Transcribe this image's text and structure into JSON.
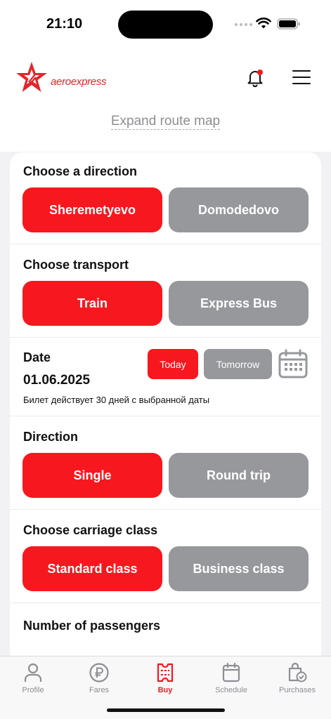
{
  "status_bar": {
    "time": "21:10"
  },
  "header": {
    "logo_text": "aeroexpress",
    "expand_map_label": "Expand route map"
  },
  "sections": {
    "route": {
      "title": "Choose a direction",
      "options": [
        "Sheremetyevo",
        "Domodedovo"
      ],
      "selected": "Sheremetyevo"
    },
    "transport": {
      "title": "Choose transport",
      "options": [
        "Train",
        "Express Bus"
      ],
      "selected": "Train"
    },
    "date": {
      "title": "Date",
      "value": "01.06.2025",
      "note": "Билет действует 30 дней с выбранной даты",
      "today_label": "Today",
      "tomorrow_label": "Tomorrow",
      "selected": "Today"
    },
    "trip_direction": {
      "title": "Direction",
      "options": [
        "Single",
        "Round trip"
      ],
      "selected": "Single"
    },
    "carriage": {
      "title": "Choose carriage class",
      "options": [
        "Standard class",
        "Business class"
      ],
      "selected": "Standard class"
    },
    "passengers": {
      "title": "Number of passengers"
    }
  },
  "tabbar": {
    "tabs": [
      {
        "label": "Profile",
        "icon": "person-icon"
      },
      {
        "label": "Fares",
        "icon": "ruble-icon"
      },
      {
        "label": "Buy",
        "icon": "ticket-icon",
        "active": true
      },
      {
        "label": "Schedule",
        "icon": "calendar-icon"
      },
      {
        "label": "Purchases",
        "icon": "shopping-bag-icon"
      }
    ]
  },
  "colors": {
    "accent": "#f7181f",
    "inactive": "#97989c",
    "brand": "#e4262a"
  }
}
